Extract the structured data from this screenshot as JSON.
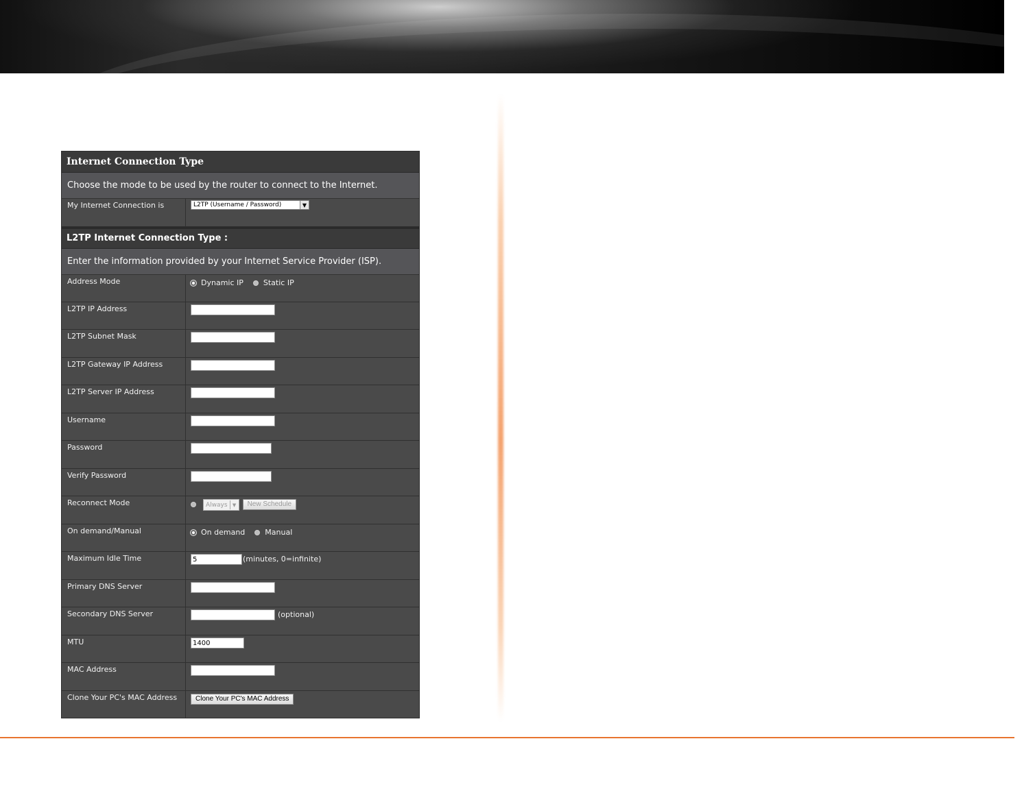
{
  "section1": {
    "title": "Internet Connection Type",
    "description": "Choose the mode to be used by the router to connect to the Internet.",
    "connection_label": "My Internet Connection is",
    "connection_value": "L2TP (Username / Password)"
  },
  "section2": {
    "title": "L2TP Internet Connection Type :",
    "description": "Enter the information provided by your Internet Service Provider (ISP)."
  },
  "fields": {
    "address_mode": {
      "label": "Address Mode",
      "options": [
        "Dynamic IP",
        "Static IP"
      ],
      "selected": "Dynamic IP"
    },
    "l2tp_ip": {
      "label": "L2TP IP Address",
      "value": ""
    },
    "l2tp_subnet": {
      "label": "L2TP Subnet Mask",
      "value": ""
    },
    "l2tp_gateway": {
      "label": "L2TP Gateway IP Address",
      "value": ""
    },
    "l2tp_server": {
      "label": "L2TP Server IP Address",
      "value": ""
    },
    "username": {
      "label": "Username",
      "value": ""
    },
    "password": {
      "label": "Password",
      "value": ""
    },
    "verify_password": {
      "label": "Verify Password",
      "value": ""
    },
    "reconnect_mode": {
      "label": "Reconnect Mode",
      "select_value": "Always",
      "schedule_button": "New Schedule"
    },
    "on_demand": {
      "label": "On demand/Manual",
      "options": [
        "On demand",
        "Manual"
      ],
      "selected": "On demand"
    },
    "max_idle": {
      "label": "Maximum Idle Time",
      "value": "5",
      "suffix": "(minutes, 0=infinite)"
    },
    "primary_dns": {
      "label": "Primary DNS Server",
      "value": ""
    },
    "secondary_dns": {
      "label": "Secondary DNS Server",
      "value": "",
      "suffix": "(optional)"
    },
    "mtu": {
      "label": "MTU",
      "value": "1400"
    },
    "mac": {
      "label": "MAC Address",
      "value": ""
    },
    "clone_mac": {
      "label": "Clone Your PC's MAC Address",
      "button": "Clone Your PC's MAC Address"
    }
  },
  "icons": {
    "dropdown": "chevron-down-icon",
    "radio": "radio-icon"
  },
  "colors": {
    "panel_bg": "#4a4a4a",
    "header_bg": "#3a3a3a",
    "accent_rule": "#e8742f"
  }
}
